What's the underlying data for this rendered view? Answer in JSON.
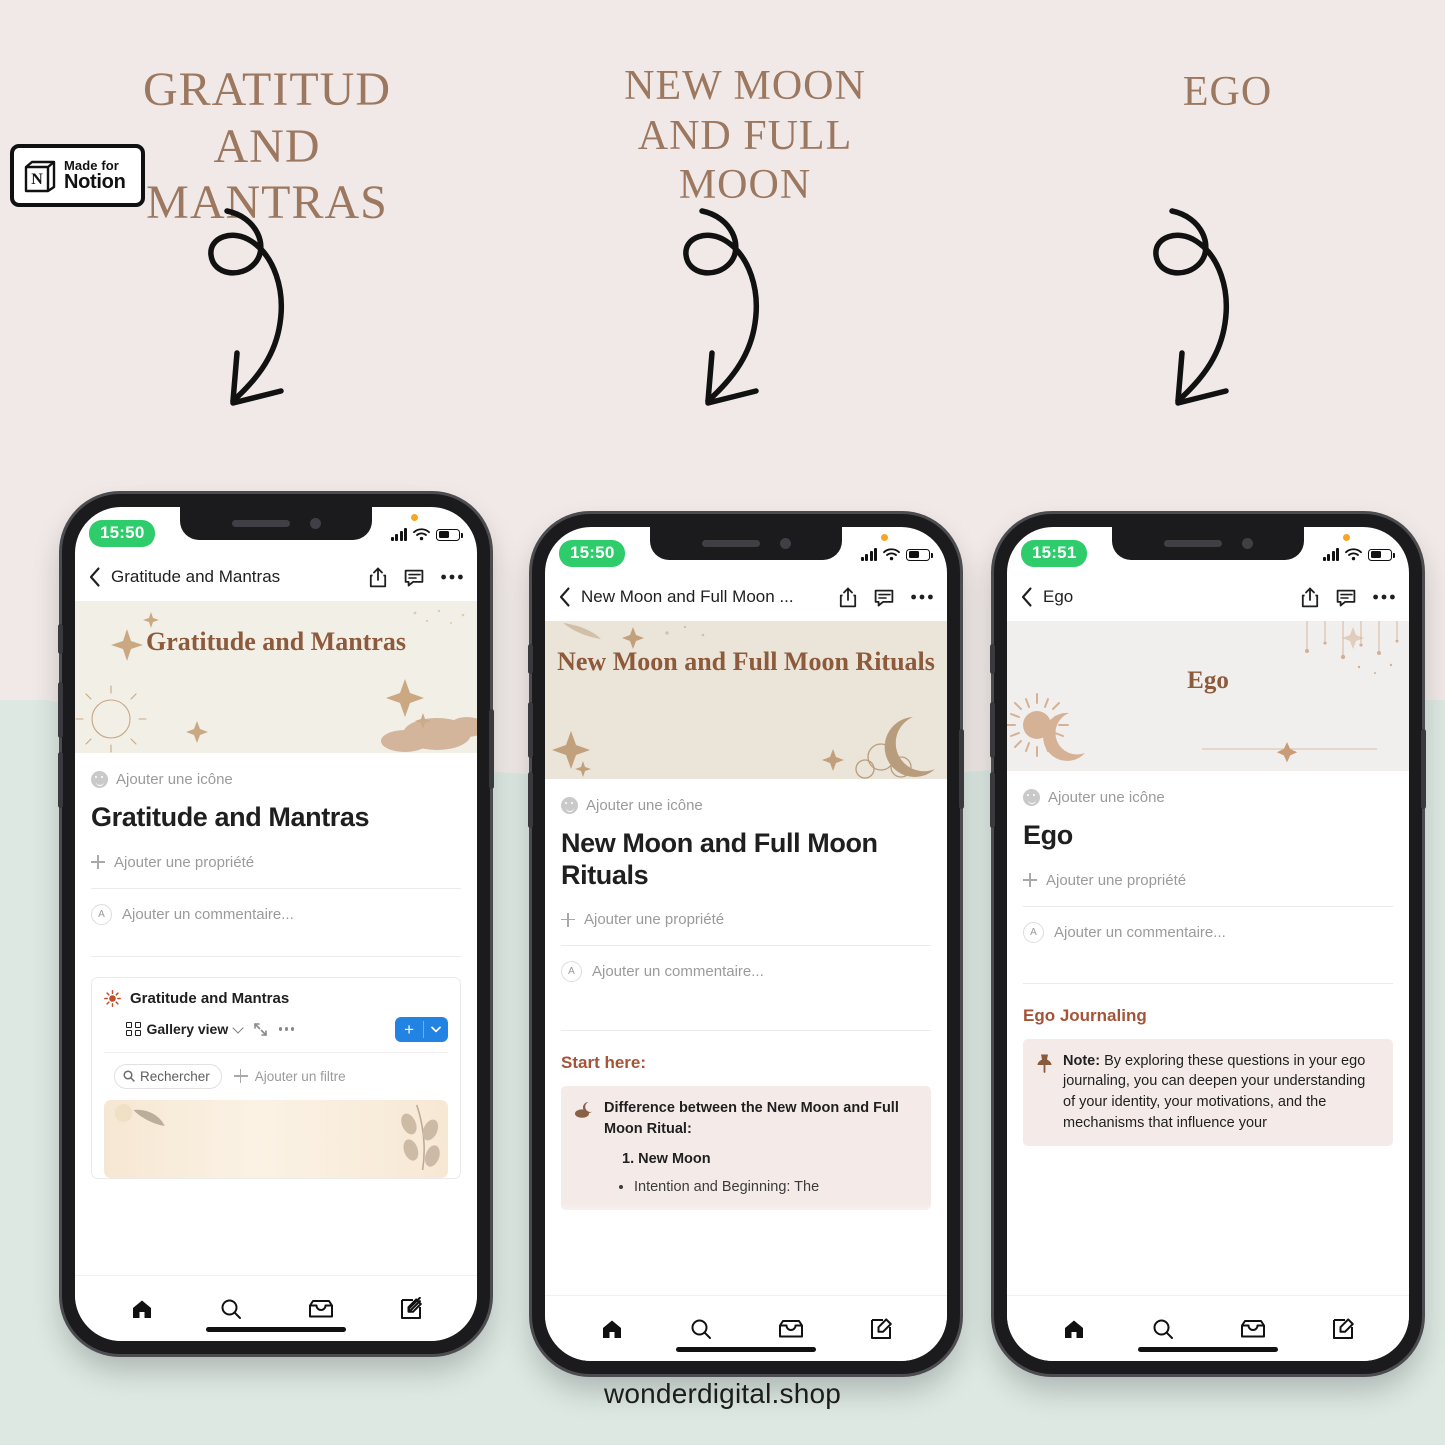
{
  "background": {
    "top_color": "#f0e9e7",
    "bottom_color": "#dde8e3"
  },
  "badge": {
    "made_for": "Made for",
    "brand": "Notion",
    "logo_letter": "N",
    "icon": "notion-cube-icon"
  },
  "headings": [
    {
      "text": "GRATITUD AND MANTRAS"
    },
    {
      "text": "NEW MOON AND FULL MOON"
    },
    {
      "text": "EGO"
    }
  ],
  "accent_color": "#9d7860",
  "doodle_icon": "curly-arrow-doodle-icon",
  "footer": {
    "text": "wonderdigital.shop"
  },
  "common": {
    "add_icon": "Ajouter une icône",
    "add_property": "Ajouter une propriété",
    "add_comment": "Ajouter un commentaire...",
    "avatar_letter": "A",
    "tabs": [
      {
        "name": "home-tab",
        "icon": "home-icon"
      },
      {
        "name": "search-tab",
        "icon": "search-icon"
      },
      {
        "name": "inbox-tab",
        "icon": "inbox-icon"
      },
      {
        "name": "new-page-tab",
        "icon": "edit-icon"
      }
    ],
    "nav_actions": [
      {
        "name": "share-button",
        "icon": "share-icon"
      },
      {
        "name": "comments-button",
        "icon": "comment-icon"
      },
      {
        "name": "more-button",
        "icon": "more-horizontal-icon"
      }
    ],
    "back_icon": "chevron-left-icon"
  },
  "phones": [
    {
      "status": {
        "time": "15:50",
        "signal": "signal-bars-icon",
        "wifi": "wifi-icon",
        "battery": "battery-icon"
      },
      "nav_title": "Gratitude and Mantras",
      "cover_title": "Gratitude and Mantras",
      "cover_bg": "#f2efe7",
      "page_title": "Gratitude and Mantras",
      "database": {
        "icon": "sun-icon",
        "title": "Gratitude and Mantras",
        "view_label": "Gallery view",
        "view_icon": "gallery-grid-icon",
        "expand_icon": "expand-arrows-icon",
        "more_icon": "more-horizontal-icon",
        "new_button": "+",
        "new_button_chevron": "chevron-down-icon",
        "search_placeholder": "Rechercher",
        "search_icon": "search-icon",
        "add_filter": "Ajouter un filtre"
      }
    },
    {
      "status": {
        "time": "15:50",
        "signal": "signal-bars-icon",
        "wifi": "wifi-icon",
        "battery": "battery-icon"
      },
      "nav_title": "New Moon and Full Moon ...",
      "cover_title": "New Moon and Full Moon Rituals",
      "cover_bg": "#ebe4d8",
      "page_title": "New Moon and Full Moon Rituals",
      "section_heading": "Start here:",
      "callout": {
        "icon": "moon-cloud-icon",
        "heading": "Difference between the New Moon and Full Moon Ritual:",
        "ordered_item": "1.  New Moon",
        "bullet_item": "Intention and Beginning: The"
      }
    },
    {
      "status": {
        "time": "15:51",
        "signal": "signal-bars-icon",
        "wifi": "wifi-icon",
        "battery": "battery-icon"
      },
      "nav_title": "Ego",
      "cover_title": "Ego",
      "cover_bg": "#f1efed",
      "page_title": "Ego",
      "section_heading": "Ego Journaling",
      "callout": {
        "icon": "pushpin-icon",
        "bold_lead": "Note:",
        "text": " By exploring these questions in your ego journaling, you can deepen your understanding of your identity, your motivations, and the mechanisms that influence your"
      }
    }
  ]
}
